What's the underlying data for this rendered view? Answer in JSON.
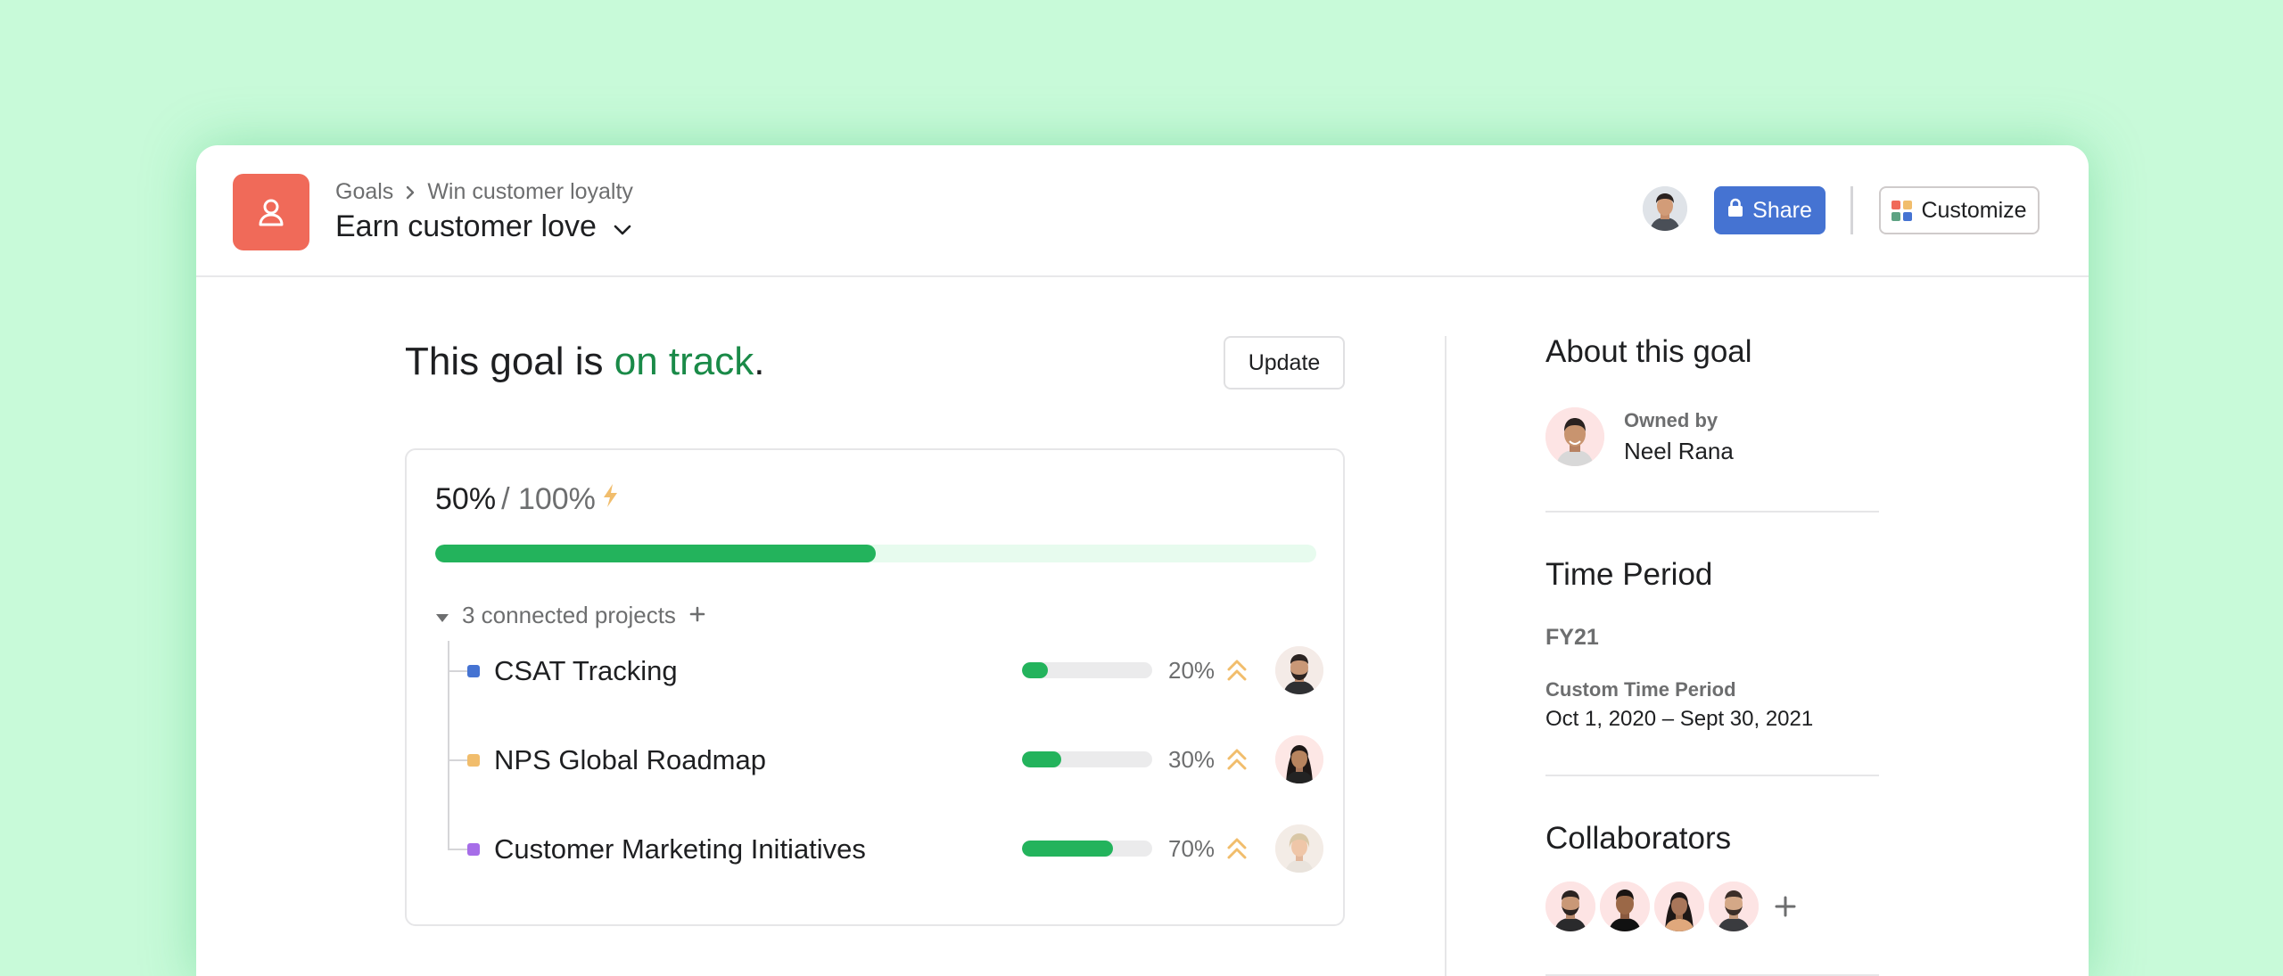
{
  "breadcrumb": {
    "parent": "Goals",
    "current": "Win customer loyalty"
  },
  "title": "Earn customer love",
  "header": {
    "share_label": "Share",
    "customize_label": "Customize"
  },
  "status": {
    "prefix": "This goal is ",
    "state": "on track",
    "suffix": "."
  },
  "update_label": "Update",
  "progress": {
    "current": "50%",
    "target": "/ 100%",
    "fraction": 0.5
  },
  "connected_projects_label": "3 connected projects",
  "projects": [
    {
      "name": "CSAT Tracking",
      "percent": "20%",
      "fraction": 0.2,
      "color": "#4573d2"
    },
    {
      "name": "NPS Global Roadmap",
      "percent": "30%",
      "fraction": 0.3,
      "color": "#f1bd6c"
    },
    {
      "name": "Customer Marketing Initiatives",
      "percent": "70%",
      "fraction": 0.7,
      "color": "#a66de8"
    }
  ],
  "about": {
    "heading": "About this goal",
    "owned_by_label": "Owned by",
    "owner_name": "Neel Rana"
  },
  "time_period": {
    "heading": "Time Period",
    "fiscal": "FY21",
    "custom_label": "Custom Time Period",
    "range": "Oct 1, 2020 – Sept 30, 2021"
  },
  "collaborators": {
    "heading": "Collaborators"
  },
  "colors": {
    "background": "#c8fad9",
    "goal_icon": "#f06a59",
    "share_button": "#4573d2",
    "on_track": "#1a8a48",
    "progress_fill": "#23b35c",
    "chevron": "#f1bd6c"
  },
  "icons": {
    "goal": "goal-person-icon",
    "breadcrumb_separator": "chevron-right-icon",
    "title_menu": "chevron-down-icon",
    "share": "lock-icon",
    "customize": "apps-grid-icon",
    "progress_lightning": "lightning-icon",
    "collapse": "caret-down-icon",
    "add": "plus-icon",
    "priority": "double-chevron-up-icon"
  }
}
